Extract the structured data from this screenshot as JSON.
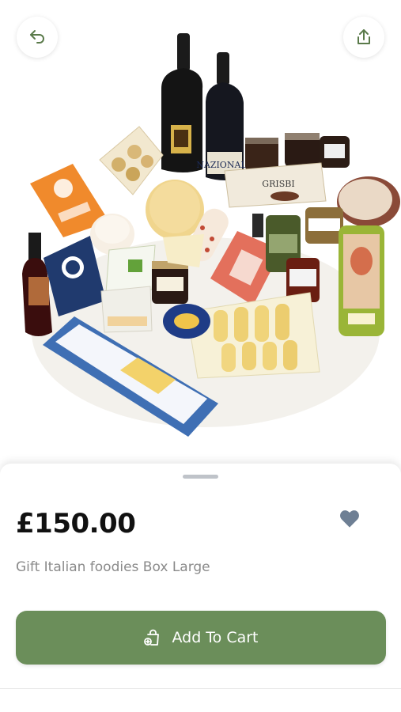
{
  "product": {
    "price": "£150.00",
    "name": "Gift Italian foodies Box Large"
  },
  "actions": {
    "add_to_cart_label": "Add To Cart"
  },
  "bottle_labels": {
    "wine_right": "NAZIONALE",
    "biscuit_box": "GRISBI"
  },
  "icons": {
    "back": "undo-arrow-icon",
    "share": "share-icon",
    "favorite": "heart-icon",
    "cart": "shopping-bag-add-icon"
  },
  "colors": {
    "accent": "#6b8e5a",
    "icon_green": "#5a7a4a",
    "heart": "#6e7f94",
    "price_text": "#111111",
    "name_text": "#8a8a8a"
  }
}
